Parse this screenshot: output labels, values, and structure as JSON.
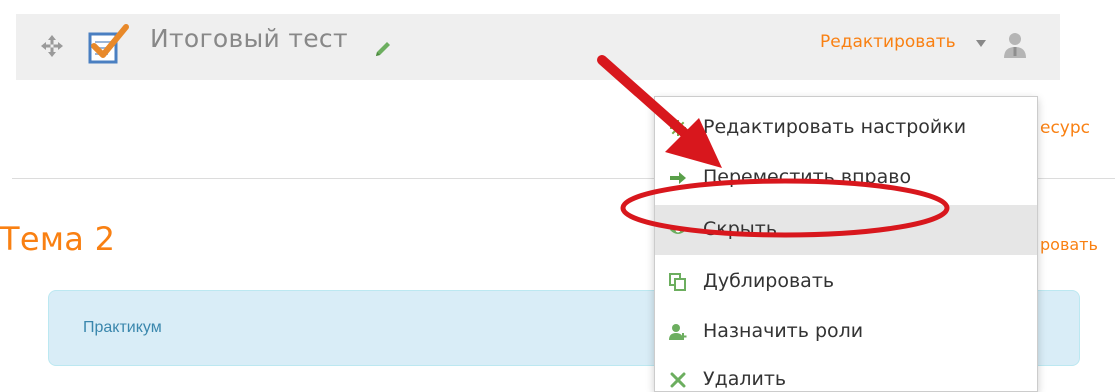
{
  "activity": {
    "name": "Итоговый тест",
    "edit_menu_label": "Редактировать"
  },
  "section": {
    "title": "Тема 2",
    "add_resource_fragment": "есурс",
    "edit_fragment": "ровать"
  },
  "info_box": {
    "text": "Практикум"
  },
  "menu": {
    "items": [
      {
        "label": "Редактировать настройки",
        "icon": "gear-icon",
        "icon_color": "#78a949"
      },
      {
        "label": "Переместить вправо",
        "icon": "arrow-right-icon",
        "icon_color": "#5aa04a"
      },
      {
        "label": "Скрыть",
        "icon": "eye-icon",
        "icon_color": "#6cae5f"
      },
      {
        "label": "Дублировать",
        "icon": "duplicate-icon",
        "icon_color": "#6cae5f"
      },
      {
        "label": "Назначить роли",
        "icon": "assign-roles-icon",
        "icon_color": "#6cae5f"
      },
      {
        "label": "Удалить",
        "icon": "delete-icon",
        "icon_color": "#6cae5f"
      }
    ]
  },
  "colors": {
    "accent": "#f98012",
    "annotation_red": "#d8171d"
  }
}
